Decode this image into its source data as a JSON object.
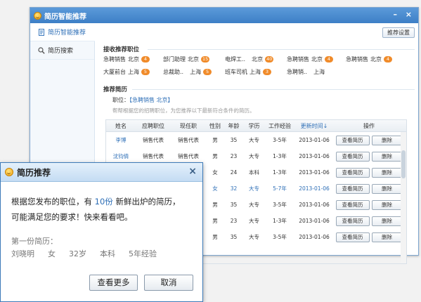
{
  "window": {
    "title": "简历智能推荐",
    "minimize": "–",
    "close": "×"
  },
  "sidebar": {
    "items": [
      {
        "label": "简历智能推荐",
        "icon": "document-icon"
      },
      {
        "label": "简历搜索",
        "icon": "search-icon"
      }
    ]
  },
  "toolbar": {
    "settings_label": "推荐设置"
  },
  "received_section": {
    "title": "接收推荐职位"
  },
  "jobs": [
    {
      "title": "急聘销售",
      "city": "北京",
      "count": "4"
    },
    {
      "title": "部门助理",
      "city": "北京",
      "count": "15"
    },
    {
      "title": "电焊工..",
      "city": "北京",
      "count": "40"
    },
    {
      "title": "急聘销售",
      "city": "北京",
      "count": "4"
    },
    {
      "title": "急聘销售",
      "city": "北京",
      "count": "4"
    },
    {
      "title": "大厦前台",
      "city": "上海",
      "count": "5"
    },
    {
      "title": "总裁助..",
      "city": "上海",
      "count": "5"
    },
    {
      "title": "班车司机",
      "city": "上海",
      "count": "3"
    },
    {
      "title": "急聘销..",
      "city": "上海",
      "count": ""
    }
  ],
  "resume_section": {
    "title": "推荐简历"
  },
  "position": {
    "label": "职位：",
    "value": "【急聘销售  北京】"
  },
  "hint": "帮帮根据您的招聘职位，为您推荐以下最新符合条件的简历。",
  "table": {
    "columns": [
      "姓名",
      "应聘职位",
      "现任职",
      "性别",
      "年龄",
      "学历",
      "工作经验",
      "更新时间",
      "操作"
    ],
    "sort_arrow": "↓",
    "view_label": "查看简历",
    "delete_label": "删除",
    "rows": [
      [
        "李博",
        "销售代表",
        "销售代表",
        "男",
        "35",
        "大专",
        "3-5年",
        "2013-01-06"
      ],
      [
        "沈钧倩",
        "销售代表",
        "销售代表",
        "男",
        "23",
        "大专",
        "1-3年",
        "2013-01-06"
      ],
      [
        "",
        "",
        "",
        "女",
        "24",
        "本科",
        "1-3年",
        "2013-01-06"
      ],
      [
        "",
        "",
        "",
        "女",
        "32",
        "大专",
        "5-7年",
        "2013-01-06"
      ],
      [
        "",
        "",
        "",
        "男",
        "35",
        "大专",
        "3-5年",
        "2013-01-06"
      ],
      [
        "",
        "",
        "",
        "男",
        "23",
        "大专",
        "1-3年",
        "2013-01-06"
      ],
      [
        "",
        "",
        "",
        "男",
        "35",
        "大专",
        "3-5年",
        "2013-01-06"
      ]
    ]
  },
  "popup": {
    "title": "简历推荐",
    "close": "×",
    "msg_part1": "根据您发布的职位，有",
    "msg_count": "10份",
    "msg_part2": "新鲜出炉的简历，",
    "msg_line2": "可能满足您的要求！快来看看吧。",
    "sub_label": "第一份简历：",
    "first_resume": [
      "刘晓明",
      "女",
      "32岁",
      "本科",
      "5年经验"
    ],
    "more_label": "查看更多",
    "cancel_label": "取消"
  }
}
